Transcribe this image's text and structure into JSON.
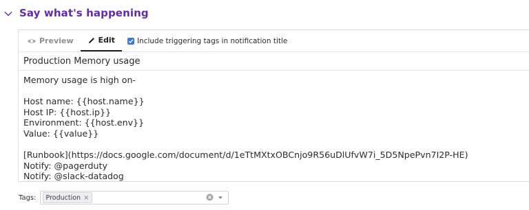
{
  "section": {
    "title": "Say what's happening",
    "toggle_icon": "chevron-down-icon"
  },
  "tabs": [
    {
      "label": "Preview",
      "icon": "eye-icon",
      "active": false
    },
    {
      "label": "Edit",
      "icon": "pencil-icon",
      "active": true
    }
  ],
  "include_tags": {
    "checked": true,
    "label": "Include triggering tags in notification title"
  },
  "notification": {
    "title": "Production Memory usage",
    "body_lines": [
      "Memory usage is high on-",
      "",
      "Host name: {{host.name}}",
      "Host IP: {{host.ip}}",
      "Environment: {{host.env}}",
      "Value: {{value}}",
      "",
      "[Runbook](https://docs.google.com/document/d/1eTtMXtxOBCnjo9R56uDlUfvW7i_5D5NpePvn7I2P-HE)",
      "Notify: @pagerduty",
      "Notify: @slack-datadog"
    ]
  },
  "tags": {
    "label": "Tags:",
    "chips": [
      {
        "label": "Production",
        "remove": "×"
      }
    ]
  },
  "colors": {
    "section_title": "#632ca6",
    "checkbox": "#3a7bd5"
  }
}
